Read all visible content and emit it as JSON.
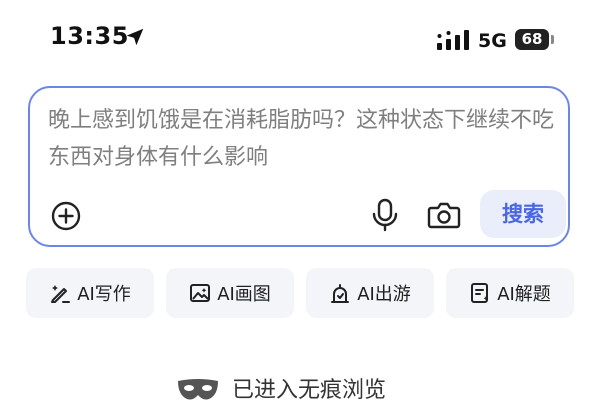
{
  "status_bar": {
    "time": "13:35",
    "network": "5G",
    "battery": "68",
    "icons": [
      "location-arrow-icon",
      "signal-icon"
    ]
  },
  "search": {
    "query": "晚上感到饥饿是在消耗脂肪吗？这种状态下继续不吃东西对身体有什么影响",
    "button_label": "搜索",
    "accent_color": "#6c86e6",
    "icons": [
      "plus-icon",
      "microphone-icon",
      "camera-icon"
    ]
  },
  "ai_tools": [
    {
      "label": "AI写作",
      "icon": "pen-sparkle-icon"
    },
    {
      "label": "AI画图",
      "icon": "image-sparkle-icon"
    },
    {
      "label": "AI出游",
      "icon": "travel-icon"
    },
    {
      "label": "AI解题",
      "icon": "question-doc-icon"
    }
  ],
  "incognito": {
    "label": "已进入无痕浏览",
    "icon": "mask-icon"
  }
}
